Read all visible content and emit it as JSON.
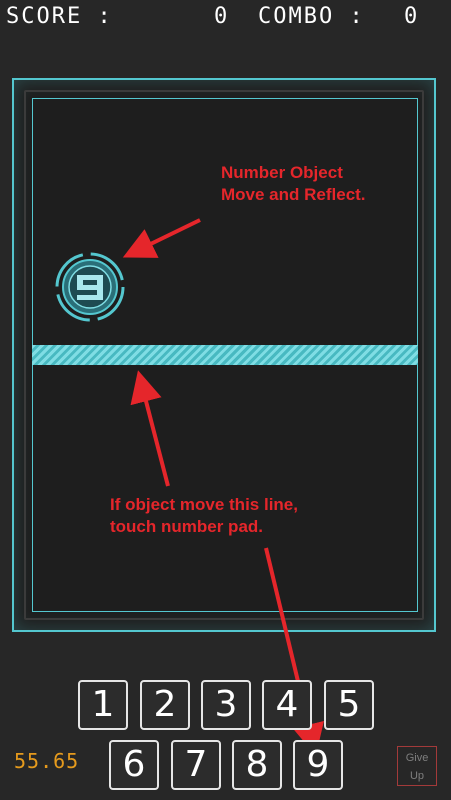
{
  "hud": {
    "score_label": "SCORE :",
    "score_value": "0",
    "combo_label": "COMBO :",
    "combo_value": "0"
  },
  "number_object": {
    "digit": "9",
    "icon": "number-object-icon"
  },
  "annotations": {
    "top_line1": "Number Object",
    "top_line2": "Move and Reflect.",
    "bottom_line1": "If object move this line,",
    "bottom_line2": "touch number pad."
  },
  "number_pad": {
    "row1": [
      "1",
      "2",
      "3",
      "4",
      "5"
    ],
    "row2": [
      "6",
      "7",
      "8",
      "9"
    ]
  },
  "timer": "55.65",
  "give_up": {
    "line1": "Give",
    "line2": "Up"
  },
  "colors": {
    "accent": "#54c7cf",
    "annotation": "#e5262b",
    "timer": "#e59a1d",
    "background": "#272727"
  }
}
